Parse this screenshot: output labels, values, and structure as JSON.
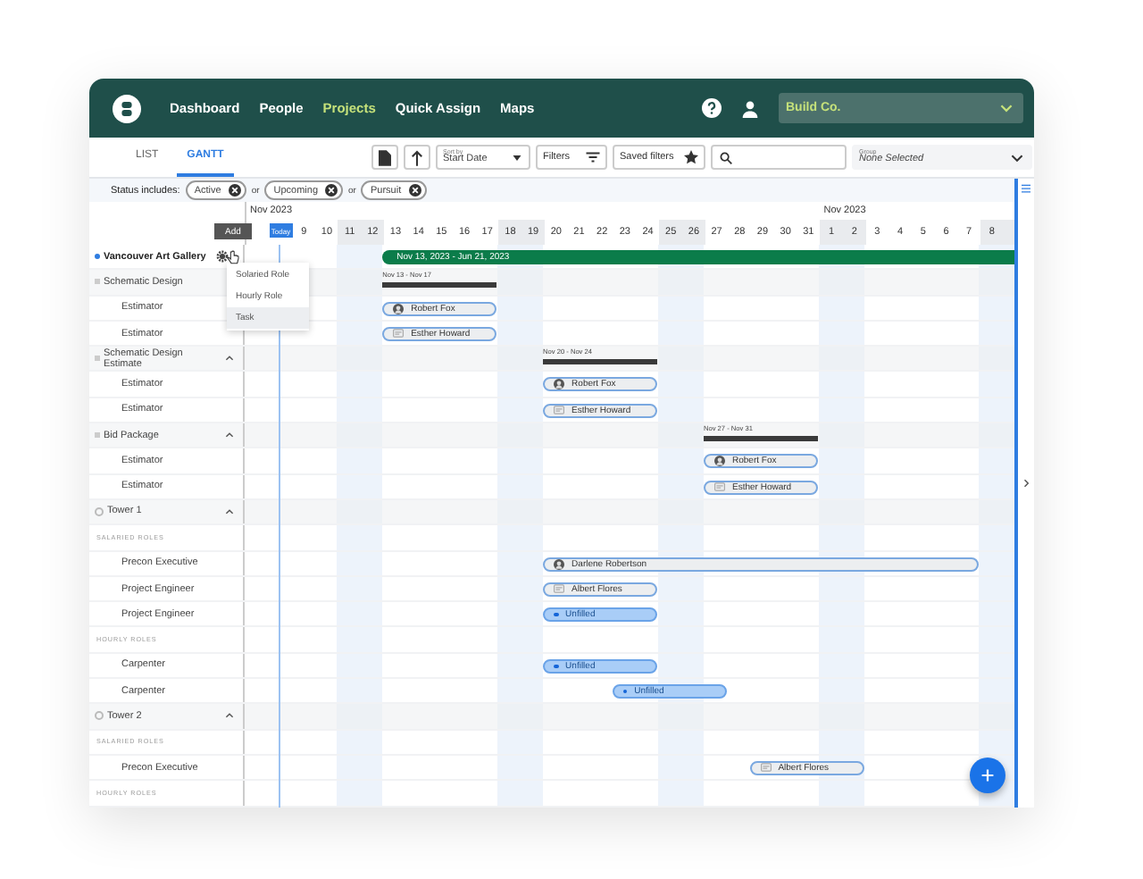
{
  "header": {
    "nav": [
      {
        "label": "Dashboard",
        "selected": false
      },
      {
        "label": "People",
        "selected": false
      },
      {
        "label": "Projects",
        "selected": true
      },
      {
        "label": "Quick Assign",
        "selected": false
      },
      {
        "label": "Maps",
        "selected": false
      }
    ],
    "company": "Build Co."
  },
  "toolbar": {
    "tabs": [
      {
        "label": "LIST",
        "selected": false
      },
      {
        "label": "GANTT",
        "selected": true
      }
    ],
    "sort": {
      "label": "Sort by",
      "value": "Start Date"
    },
    "filters": "Filters",
    "saved_filters": "Saved filters",
    "group": {
      "label": "Group",
      "value": "None Selected"
    }
  },
  "status": {
    "label": "Status includes:",
    "items": [
      {
        "kind": "chip",
        "label": "Active"
      },
      {
        "kind": "joiner",
        "label": "or"
      },
      {
        "kind": "chip",
        "label": "Upcoming"
      },
      {
        "kind": "joiner",
        "label": "or"
      },
      {
        "kind": "chip",
        "label": "Pursuit"
      }
    ]
  },
  "gantt": {
    "add_button": "Add",
    "today": "Today",
    "months": [
      "Nov 2023",
      "Nov 2023"
    ],
    "days": [
      {
        "label": "9",
        "weekend": false
      },
      {
        "label": "10",
        "weekend": false
      },
      {
        "label": "11",
        "weekend": true
      },
      {
        "label": "12",
        "weekend": true
      },
      {
        "label": "13",
        "weekend": false
      },
      {
        "label": "14",
        "weekend": false
      },
      {
        "label": "15",
        "weekend": false
      },
      {
        "label": "16",
        "weekend": false
      },
      {
        "label": "17",
        "weekend": false
      },
      {
        "label": "18",
        "weekend": true
      },
      {
        "label": "19",
        "weekend": true
      },
      {
        "label": "20",
        "weekend": false
      },
      {
        "label": "21",
        "weekend": false
      },
      {
        "label": "22",
        "weekend": false
      },
      {
        "label": "23",
        "weekend": false
      },
      {
        "label": "24",
        "weekend": false
      },
      {
        "label": "25",
        "weekend": true
      },
      {
        "label": "26",
        "weekend": true
      },
      {
        "label": "27",
        "weekend": false
      },
      {
        "label": "28",
        "weekend": false
      },
      {
        "label": "29",
        "weekend": false
      },
      {
        "label": "30",
        "weekend": false
      },
      {
        "label": "31",
        "weekend": false
      },
      {
        "label": "1",
        "weekend": true
      },
      {
        "label": "2",
        "weekend": true
      },
      {
        "label": "3",
        "weekend": false
      },
      {
        "label": "4",
        "weekend": false
      },
      {
        "label": "5",
        "weekend": false
      },
      {
        "label": "6",
        "weekend": false
      },
      {
        "label": "7",
        "weekend": false
      },
      {
        "label": "8",
        "weekend": true
      }
    ],
    "menu": [
      {
        "label": "Solaried Role",
        "selected": false
      },
      {
        "label": "Hourly Role",
        "selected": false
      },
      {
        "label": "Task",
        "selected": true
      }
    ],
    "rows": [
      {
        "kind": "project",
        "label": "Vancouver Art Gallery",
        "bar": "Nov 13, 2023 - Jun 21, 2023",
        "children": [
          {
            "kind": "phase",
            "label": "Schematic Design",
            "bar": "Nov 13 - Nov 17",
            "children": [
              {
                "kind": "role",
                "label": "Estimator",
                "assignment": {
                  "kind": "person",
                  "name": "Robert Fox"
                }
              },
              {
                "kind": "role",
                "label": "Estimator",
                "assignment": {
                  "kind": "placeholder",
                  "name": "Esther Howard"
                }
              }
            ]
          },
          {
            "kind": "phase",
            "label": "Schematic Design Estimate",
            "expanded": true,
            "bar": "Nov 20 - Nov 24",
            "children": [
              {
                "kind": "role",
                "label": "Estimator",
                "assignment": {
                  "kind": "person",
                  "name": "Robert Fox"
                }
              },
              {
                "kind": "role",
                "label": "Estimator",
                "assignment": {
                  "kind": "placeholder",
                  "name": "Esther Howard"
                }
              }
            ]
          },
          {
            "kind": "phase",
            "label": "Bid Package",
            "expanded": true,
            "bar": "Nov 27 - Nov 31",
            "children": [
              {
                "kind": "role",
                "label": "Estimator",
                "assignment": {
                  "kind": "person",
                  "name": "Robert Fox"
                }
              },
              {
                "kind": "role",
                "label": "Estimator",
                "assignment": {
                  "kind": "placeholder",
                  "name": "Esther Howard"
                }
              }
            ]
          },
          {
            "kind": "building",
            "label": "Tower 1",
            "expanded": true,
            "children": [
              {
                "kind": "section",
                "label": "SALARIED ROLES",
                "children": [
                  {
                    "kind": "role",
                    "label": "Precon Executive",
                    "assignment": {
                      "kind": "person",
                      "name": "Darlene Robertson"
                    }
                  },
                  {
                    "kind": "role",
                    "label": "Project Engineer",
                    "assignment": {
                      "kind": "placeholder",
                      "name": "Albert Flores"
                    }
                  },
                  {
                    "kind": "role",
                    "label": "Project Engineer",
                    "assignment": {
                      "kind": "unfilled",
                      "name": "Unfilled"
                    }
                  }
                ]
              },
              {
                "kind": "section",
                "label": "HOURLY ROLES",
                "children": [
                  {
                    "kind": "role",
                    "label": "Carpenter",
                    "assignment": {
                      "kind": "unfilled",
                      "name": "Unfilled"
                    }
                  },
                  {
                    "kind": "role",
                    "label": "Carpenter",
                    "assignment": {
                      "kind": "unfilled",
                      "name": "Unfilled"
                    }
                  }
                ]
              }
            ]
          },
          {
            "kind": "building",
            "label": "Tower 2",
            "expanded": true,
            "children": [
              {
                "kind": "section",
                "label": "SALARIED ROLES",
                "children": [
                  {
                    "kind": "role",
                    "label": "Precon Executive",
                    "assignment": {
                      "kind": "placeholder",
                      "name": "Albert Flores"
                    }
                  }
                ]
              },
              {
                "kind": "section",
                "label": "HOURLY ROLES"
              }
            ]
          }
        ]
      }
    ]
  }
}
